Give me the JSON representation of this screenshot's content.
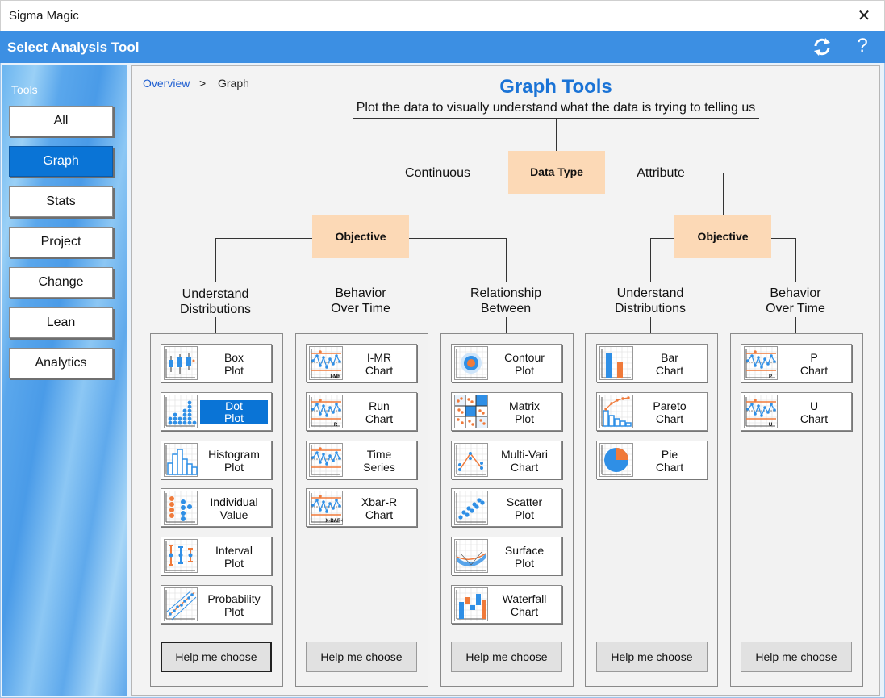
{
  "window": {
    "title": "Sigma Magic",
    "close_glyph": "✕"
  },
  "header": {
    "title": "Select Analysis Tool",
    "refresh_icon": "refresh-icon",
    "help_glyph": "?"
  },
  "sidebar": {
    "title": "Tools",
    "items": [
      {
        "label": "All"
      },
      {
        "label": "Graph",
        "active": true
      },
      {
        "label": "Stats"
      },
      {
        "label": "Project"
      },
      {
        "label": "Change"
      },
      {
        "label": "Lean"
      },
      {
        "label": "Analytics"
      }
    ]
  },
  "breadcrumb": {
    "link": "Overview",
    "separator": ">",
    "current": "Graph"
  },
  "main": {
    "title": "Graph Tools",
    "subtitle": "Plot the data to visually understand what the data is trying to telling us",
    "data_type": "Data Type",
    "continuous": "Continuous",
    "attribute": "Attribute",
    "objective": "Objective",
    "categories": [
      {
        "line1": "Understand",
        "line2": "Distributions"
      },
      {
        "line1": "Behavior",
        "line2": "Over Time"
      },
      {
        "line1": "Relationship",
        "line2": "Between"
      },
      {
        "line1": "Understand",
        "line2": "Distributions"
      },
      {
        "line1": "Behavior",
        "line2": "Over Time"
      }
    ],
    "panels": [
      {
        "tools": [
          {
            "line1": "Box",
            "line2": "Plot",
            "icon": "box-plot-icon"
          },
          {
            "line1": "Dot",
            "line2": "Plot",
            "icon": "dot-plot-icon",
            "selected": true
          },
          {
            "line1": "Histogram",
            "line2": "Plot",
            "icon": "histogram-icon"
          },
          {
            "line1": "Individual",
            "line2": "Value",
            "icon": "individual-value-icon"
          },
          {
            "line1": "Interval",
            "line2": "Plot",
            "icon": "interval-plot-icon"
          },
          {
            "line1": "Probability",
            "line2": "Plot",
            "icon": "probability-plot-icon"
          }
        ]
      },
      {
        "tools": [
          {
            "line1": "I-MR",
            "line2": "Chart",
            "icon": "imr-chart-icon",
            "tag": "I-MR"
          },
          {
            "line1": "Run",
            "line2": "Chart",
            "icon": "run-chart-icon",
            "tag": "R"
          },
          {
            "line1": "Time",
            "line2": "Series",
            "icon": "time-series-icon",
            "tag": ""
          },
          {
            "line1": "Xbar-R",
            "line2": "Chart",
            "icon": "xbar-r-chart-icon",
            "tag": "X-BAR-R"
          }
        ]
      },
      {
        "tools": [
          {
            "line1": "Contour",
            "line2": "Plot",
            "icon": "contour-plot-icon"
          },
          {
            "line1": "Matrix",
            "line2": "Plot",
            "icon": "matrix-plot-icon"
          },
          {
            "line1": "Multi-Vari",
            "line2": "Chart",
            "icon": "multi-vari-chart-icon"
          },
          {
            "line1": "Scatter",
            "line2": "Plot",
            "icon": "scatter-plot-icon"
          },
          {
            "line1": "Surface",
            "line2": "Plot",
            "icon": "surface-plot-icon"
          },
          {
            "line1": "Waterfall",
            "line2": "Chart",
            "icon": "waterfall-chart-icon"
          }
        ]
      },
      {
        "tools": [
          {
            "line1": "Bar",
            "line2": "Chart",
            "icon": "bar-chart-icon"
          },
          {
            "line1": "Pareto",
            "line2": "Chart",
            "icon": "pareto-chart-icon"
          },
          {
            "line1": "Pie",
            "line2": "Chart",
            "icon": "pie-chart-icon"
          }
        ]
      },
      {
        "tools": [
          {
            "line1": "P",
            "line2": "Chart",
            "icon": "p-chart-icon",
            "tag": "P"
          },
          {
            "line1": "U",
            "line2": "Chart",
            "icon": "u-chart-icon",
            "tag": "U"
          }
        ]
      }
    ],
    "help_label": "Help me choose"
  },
  "colors": {
    "accent": "#3c8fe3",
    "selected": "#0a74d6",
    "objective_box": "#fcd9b6",
    "title": "#1a73d6",
    "icon_blue": "#2f8fe6",
    "icon_orange": "#f07a3a"
  }
}
